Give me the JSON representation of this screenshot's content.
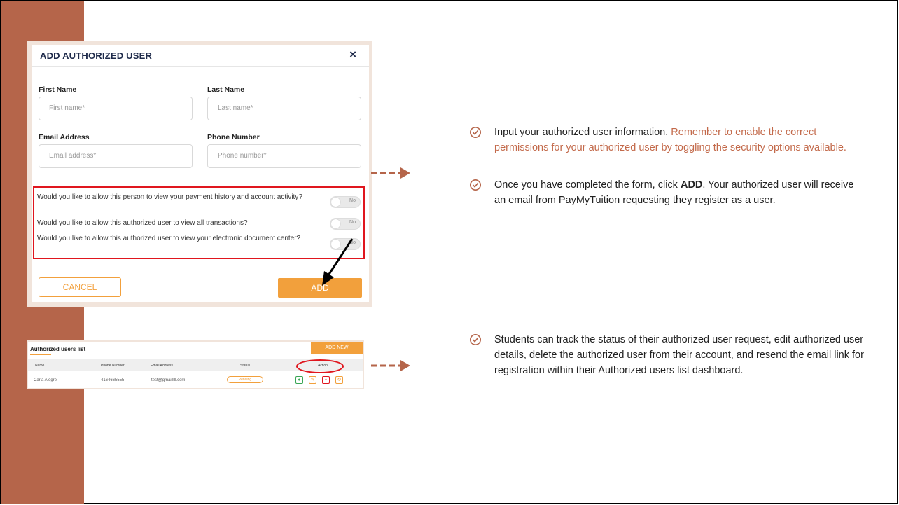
{
  "modal": {
    "title": "ADD AUTHORIZED USER",
    "close": "×",
    "first_name_label": "First Name",
    "first_name_placeholder": "First name*",
    "last_name_label": "Last Name",
    "last_name_placeholder": "Last name*",
    "email_label": "Email Address",
    "email_placeholder": "Email address*",
    "phone_label": "Phone Number",
    "phone_placeholder": "Phone number*",
    "permissions": [
      {
        "text": "Would you like to allow this person to view your payment history and account activity?",
        "toggle": "No"
      },
      {
        "text": "Would you like to allow this authorized user to view all transactions?",
        "toggle": "No"
      },
      {
        "text": "Would you like to allow this authorized user to view your electronic document center?",
        "toggle": "No"
      }
    ],
    "cancel_label": "CANCEL",
    "add_label": "ADD"
  },
  "users_list": {
    "title": "Authorized users list",
    "add_new_label": "ADD NEW",
    "columns": [
      "Name",
      "Phone Number",
      "Email Address",
      "Status",
      "Action"
    ],
    "rows": [
      {
        "name": "Carla Alegre",
        "phone": "4164665555",
        "email": "test@gmailllll.com",
        "status": "Pending"
      }
    ]
  },
  "instructions": {
    "bullet1_main": "Input your authorized user information. ",
    "bullet1_accent": "Remember to enable the correct permissions for your authorized user by toggling the security options available.",
    "bullet2_pre": "Once you have completed the form, click ",
    "bullet2_bold": "ADD",
    "bullet2_post": ". Your authorized user will receive an email from PayMyTuition requesting they register as a user.",
    "bullet3": "Students can track the status of their authorized user request, edit authorized user details, delete the authorized user from their account, and resend the email link for registration within their Authorized users list dashboard."
  },
  "colors": {
    "sidebar": "#b5654a",
    "accent_text": "#c36a4b",
    "orange": "#f2a03c",
    "highlight_red": "#e0161e"
  }
}
